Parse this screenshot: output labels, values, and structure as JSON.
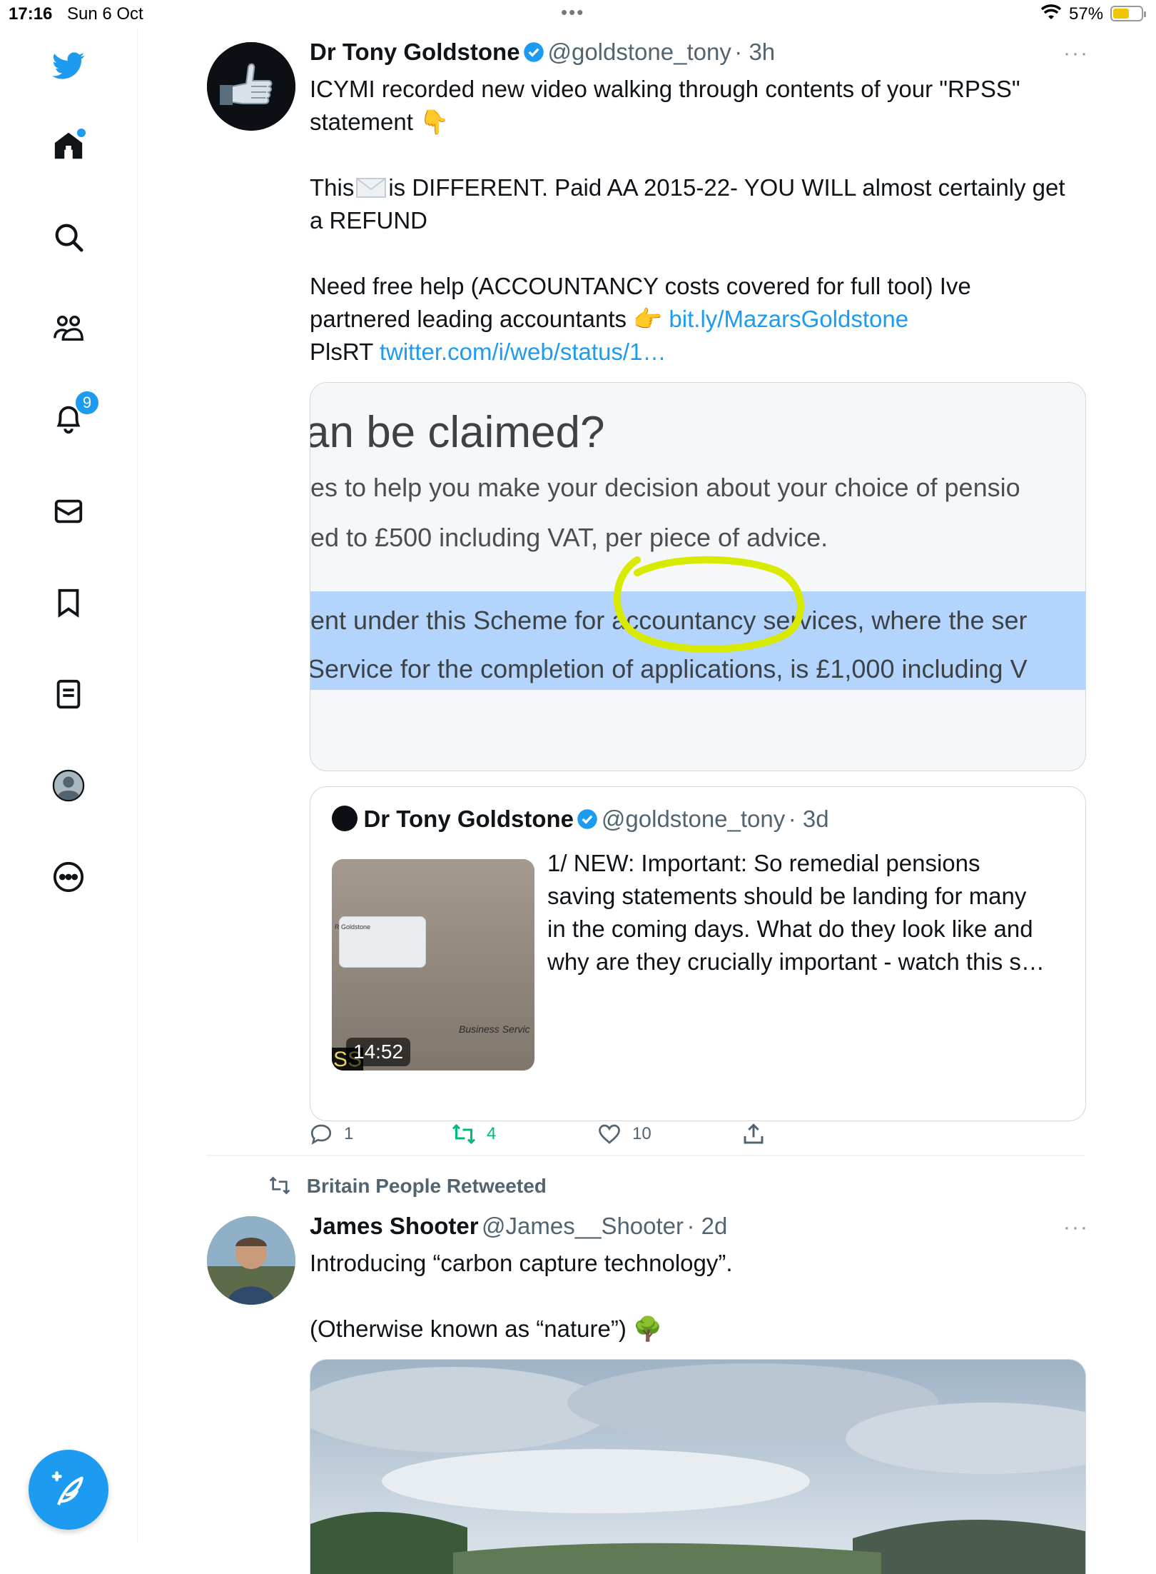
{
  "status_bar": {
    "time": "17:16",
    "date": "Sun 6 Oct",
    "battery": "57%",
    "battery_level": 0.57,
    "dots": "•••"
  },
  "sidebar": {
    "items": [
      {
        "name": "twitter-logo-icon"
      },
      {
        "name": "home-icon",
        "has_dot": true
      },
      {
        "name": "search-icon"
      },
      {
        "name": "communities-icon"
      },
      {
        "name": "notifications-icon",
        "badge": "9"
      },
      {
        "name": "messages-icon"
      },
      {
        "name": "bookmarks-icon"
      },
      {
        "name": "lists-icon"
      },
      {
        "name": "profile-icon"
      },
      {
        "name": "more-icon"
      }
    ],
    "accent": "#1d9bf0"
  },
  "tweet1": {
    "name": "Dr Tony Goldstone",
    "handle": "@goldstone_tony",
    "time": "· 3h",
    "more": "···",
    "line1": "ICYMI recorded new video walking through contents of your \"RPSS\"",
    "line2": "statement 👇",
    "line3a": "This",
    "line3b": "is DIFFERENT. Paid AA 2015-22- YOU WILL almost certainly get",
    "line4": "a REFUND",
    "line5": "Need free help (ACCOUNTANCY costs covered for full tool) Ive",
    "line6": "partnered leading accountants 👉",
    "link1": "bit.ly/MazarsGoldstone",
    "line7": "PlsRT",
    "link2": "twitter.com/i/web/status/1…",
    "image": {
      "heading": "an be claimed?",
      "line1": "es to help you make your decision about your choice of pensio",
      "line2": "ed to £500 including VAT, per piece of advice.",
      "line3": "ent under this Scheme for accountancy services, where the ser",
      "line4": "Service for the completion of applications, is £1,000 including V"
    },
    "quote": {
      "name": "Dr Tony Goldstone",
      "handle": "@goldstone_tony",
      "time": "· 3d",
      "line1": "1/ NEW: Important: So remedial pensions",
      "line2": "saving statements should be landing for many",
      "line3": "in the coming days. What do they look like and",
      "line4": "why are they crucially important - watch this s…",
      "duration": "14:52",
      "thumb_text1": "Business Servic",
      "thumb_text2": "R Goldstone",
      "thumb_text3": "SS"
    },
    "actions": {
      "replies": "1",
      "retweets": "4",
      "likes": "10"
    }
  },
  "tweet2": {
    "retweeted_by": "Britain People Retweeted",
    "name": "James Shooter",
    "handle": "@James__Shooter",
    "time": "· 2d",
    "more": "···",
    "line1": "Introducing “carbon capture technology”.",
    "line2": "(Otherwise known as “nature”) 🌳"
  }
}
